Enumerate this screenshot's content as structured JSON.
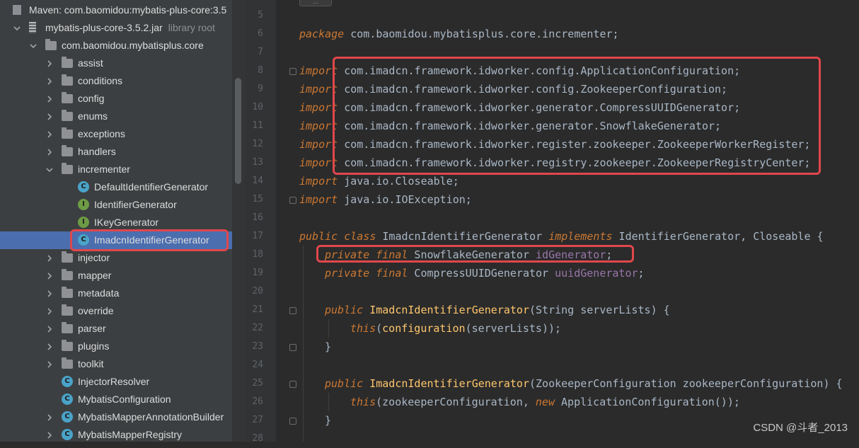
{
  "project_tree": {
    "root": {
      "label": "Maven: com.baomidou:mybatis-plus-core:3.5"
    },
    "jar": {
      "label": "mybatis-plus-core-3.5.2.jar",
      "sub": "library root"
    },
    "package": {
      "label": "com.baomidou.mybatisplus.core"
    },
    "folders_a": [
      {
        "label": "assist"
      },
      {
        "label": "conditions"
      },
      {
        "label": "config"
      },
      {
        "label": "enums"
      },
      {
        "label": "exceptions"
      },
      {
        "label": "handlers"
      }
    ],
    "incrementer": {
      "label": "incrementer"
    },
    "incrementer_children": [
      {
        "label": "DefaultIdentifierGenerator",
        "kind": "class"
      },
      {
        "label": "IdentifierGenerator",
        "kind": "interface"
      },
      {
        "label": "IKeyGenerator",
        "kind": "interface"
      },
      {
        "label": "ImadcnIdentifierGenerator",
        "kind": "class",
        "selected": true
      }
    ],
    "folders_b": [
      {
        "label": "injector"
      },
      {
        "label": "mapper"
      },
      {
        "label": "metadata"
      },
      {
        "label": "override"
      },
      {
        "label": "parser"
      },
      {
        "label": "plugins"
      },
      {
        "label": "toolkit"
      }
    ],
    "classes": [
      {
        "label": "InjectorResolver",
        "kind": "class"
      },
      {
        "label": "MybatisConfiguration",
        "kind": "class"
      },
      {
        "label": "MybatisMapperAnnotationBuilder",
        "kind": "class"
      },
      {
        "label": "MybatisMapperRegistry",
        "kind": "class"
      }
    ],
    "icon_letters": {
      "class": "C",
      "interface": "I"
    }
  },
  "editor": {
    "line_numbers": [
      "5",
      "6",
      "7",
      "8",
      "9",
      "10",
      "11",
      "12",
      "13",
      "14",
      "15",
      "16",
      "17",
      "18",
      "19",
      "20",
      "21",
      "22",
      "23",
      "24",
      "25",
      "26",
      "27",
      "28"
    ],
    "package_kw": "package",
    "package_name": " com.baomidou.mybatisplus.core.incrementer;",
    "import_kw": "import",
    "imports": [
      " com.imadcn.framework.idworker.config.ApplicationConfiguration;",
      " com.imadcn.framework.idworker.config.ZookeeperConfiguration;",
      " com.imadcn.framework.idworker.generator.CompressUUIDGenerator;",
      " com.imadcn.framework.idworker.generator.SnowflakeGenerator;",
      " com.imadcn.framework.idworker.register.zookeeper.ZookeeperWorkerRegister;",
      " com.imadcn.framework.idworker.registry.zookeeper.ZookeeperRegistryCenter;",
      " java.io.Closeable;",
      " java.io.IOException;"
    ],
    "class_decl": {
      "kw1": "public",
      "kw2": " class",
      "name": " ImadcnIdentifierGenerator ",
      "kw3": "implements",
      "rest": " IdentifierGenerator, Closeable {"
    },
    "field1": {
      "kw1": "private",
      "kw2": " final",
      "type": " SnowflakeGenerator ",
      "name": "idGenerator",
      "end": ";"
    },
    "field2": {
      "kw1": "private",
      "kw2": " final",
      "type": " CompressUUIDGenerator ",
      "name": "uuidGenerator",
      "end": ";"
    },
    "ctor1": {
      "kw": "public",
      "name": " ImadcnIdentifierGenerator",
      "sig": "(String ",
      "param": "serverLists",
      "end": ") {"
    },
    "ctor1_body": {
      "kw": "this",
      "a": "(",
      "call": "configuration",
      "b": "(",
      "arg": "serverLists",
      "c": "));"
    },
    "close_brace": "}",
    "ctor2": {
      "kw": "public",
      "name": " ImadcnIdentifierGenerator",
      "sig": "(ZookeeperConfiguration ",
      "param": "zookeeperConfiguration",
      "end": ") {"
    },
    "ctor2_body": {
      "kw": "this",
      "a": "(",
      "arg": "zookeeperConfiguration",
      "b": ", ",
      "kw2": "new",
      "c": " ApplicationConfiguration());"
    },
    "fold_marker": "..."
  },
  "watermark": "CSDN @斗者_2013",
  "colors": {
    "highlight": "#e0474c",
    "selection": "#4b6eaf",
    "keyword": "#cc7832",
    "field": "#9876aa",
    "method": "#ffc66d",
    "text": "#a9b7c6"
  }
}
